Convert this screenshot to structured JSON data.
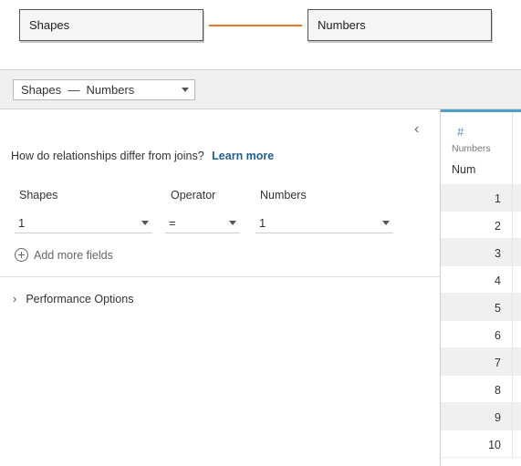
{
  "canvas": {
    "left_table": "Shapes",
    "right_table": "Numbers"
  },
  "relationship": {
    "selected": "Shapes  —  Numbers"
  },
  "panel": {
    "help_text": "How do relationships differ from joins?",
    "learn_more": "Learn more",
    "columns": {
      "left_label": "Shapes",
      "operator_label": "Operator",
      "right_label": "Numbers"
    },
    "fields": {
      "left_value": "1",
      "operator_value": "=",
      "right_value": "1"
    },
    "add_fields": "Add more fields",
    "performance": "Performance Options"
  },
  "grid": {
    "source": "Numbers",
    "column": "Num",
    "rows": [
      "1",
      "2",
      "3",
      "4",
      "5",
      "6",
      "7",
      "8",
      "9",
      "10"
    ]
  },
  "colors": {
    "noodle": "#e8762b",
    "link": "#1f5f99",
    "header_accent": "#4fa0c8"
  }
}
